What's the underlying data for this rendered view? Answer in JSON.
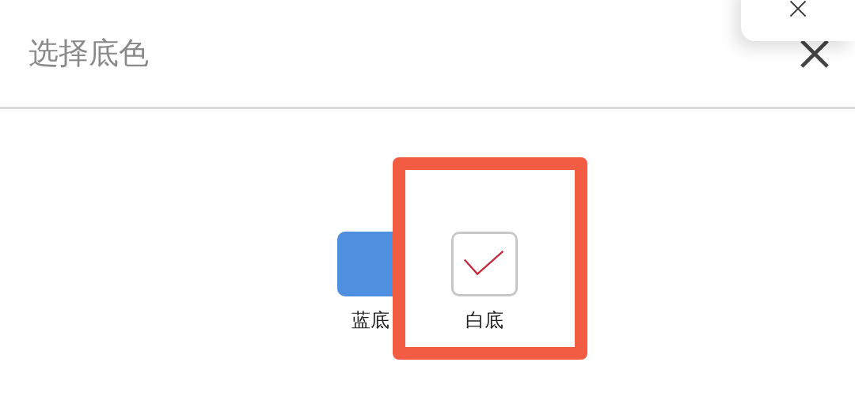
{
  "dialog": {
    "title": "选择底色"
  },
  "options": [
    {
      "label": "蓝底",
      "color": "#4f8fe0",
      "selected": false
    },
    {
      "label": "白底",
      "color": "#ffffff",
      "selected": true
    }
  ]
}
